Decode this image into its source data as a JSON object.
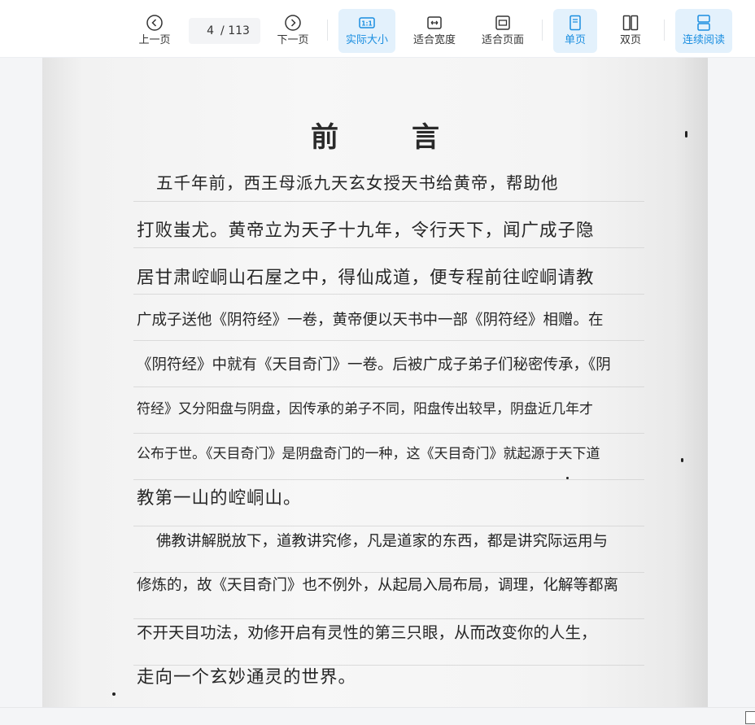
{
  "toolbar": {
    "prev_label": "上一页",
    "next_label": "下一页",
    "current_page": "4",
    "total_pages": "/ 113",
    "actual_size_label": "实际大小",
    "actual_size_badge": "1:1",
    "fit_width_label": "适合宽度",
    "fit_page_label": "适合页面",
    "single_page_label": "单页",
    "double_page_label": "双页",
    "continuous_label": "连续阅读",
    "active_color": "#1a8ee0",
    "active_bg": "#e3f1fc"
  },
  "document": {
    "heading": "前言",
    "lines": [
      "五千年前，西王母派九天玄女授天书给黄帝，帮助他",
      "打败蚩尤。黄帝立为天子十九年，令行天下，闻广成子隐",
      "居甘肃崆峒山石屋之中，得仙成道，便专程前往崆峒请教",
      "广成子送他《阴符经》一卷，黄帝便以天书中一部《阴符经》相赠。在",
      "《阴符经》中就有《天目奇门》一卷。后被广成子弟子们秘密传承，《阴",
      "符经》又分阳盘与阴盘，因传承的弟子不同，阳盘传出较早，阴盘近几年才",
      "公布于世。《天目奇门》是阴盘奇门的一种，这《天目奇门》就起源于天下道",
      "教第一山的崆峒山。",
      "佛教讲解脱放下，道教讲究修，凡是道家的东西，都是讲究际运用与",
      "修炼的，故《天目奇门》也不例外，从起局入局布局，调理，化解等都离",
      "不开天目功法，劝修开启有灵性的第三只眼，从而改变你的人生，",
      "走向一个玄妙通灵的世界。"
    ]
  }
}
